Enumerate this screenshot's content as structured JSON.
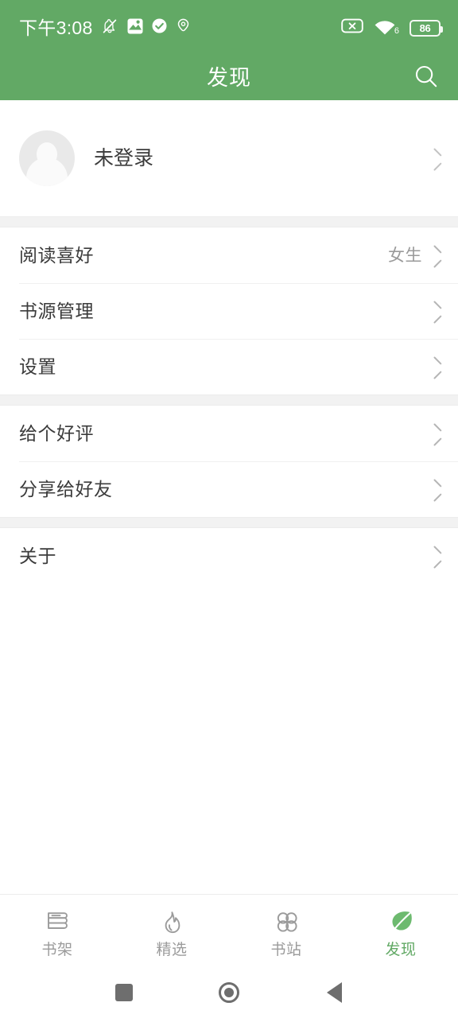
{
  "status_bar": {
    "time": "下午3:08",
    "battery_level": "86",
    "wifi_generation": "6",
    "icons": [
      "mute-bell-icon",
      "app-sync-icon",
      "check-circle-icon",
      "location-pin-icon",
      "no-sim-icon",
      "wifi-icon",
      "battery-icon"
    ]
  },
  "app_bar": {
    "title": "发现",
    "search_icon": "search-icon"
  },
  "profile": {
    "name": "未登录",
    "avatar_icon": "default-avatar-icon",
    "chevron_icon": "chevron-right-icon"
  },
  "groups": [
    {
      "rows": [
        {
          "label": "阅读喜好",
          "value": "女生",
          "chevron_icon": "chevron-right-icon"
        },
        {
          "label": "书源管理",
          "value": "",
          "chevron_icon": "chevron-right-icon"
        },
        {
          "label": "设置",
          "value": "",
          "chevron_icon": "chevron-right-icon"
        }
      ]
    },
    {
      "rows": [
        {
          "label": "给个好评",
          "value": "",
          "chevron_icon": "chevron-right-icon"
        },
        {
          "label": "分享给好友",
          "value": "",
          "chevron_icon": "chevron-right-icon"
        }
      ]
    },
    {
      "rows": [
        {
          "label": "关于",
          "value": "",
          "chevron_icon": "chevron-right-icon"
        }
      ]
    }
  ],
  "tab_bar": {
    "active_index": 3,
    "active_color": "#62a965",
    "inactive_color": "#9b9b9b",
    "tabs": [
      {
        "label": "书架",
        "icon": "bookshelf-icon"
      },
      {
        "label": "精选",
        "icon": "flame-icon"
      },
      {
        "label": "书站",
        "icon": "four-circles-icon"
      },
      {
        "label": "发现",
        "icon": "leaf-icon"
      }
    ]
  },
  "nav_bar": {
    "buttons": [
      {
        "name": "recents",
        "icon": "square-icon"
      },
      {
        "name": "home",
        "icon": "circle-icon"
      },
      {
        "name": "back",
        "icon": "triangle-left-icon"
      }
    ]
  },
  "theme": {
    "primary": "#62a965",
    "page_bg": "#f4f4f4",
    "card_bg": "#ffffff",
    "text_primary": "#3b3b3b",
    "text_secondary": "#9a9a9a"
  }
}
